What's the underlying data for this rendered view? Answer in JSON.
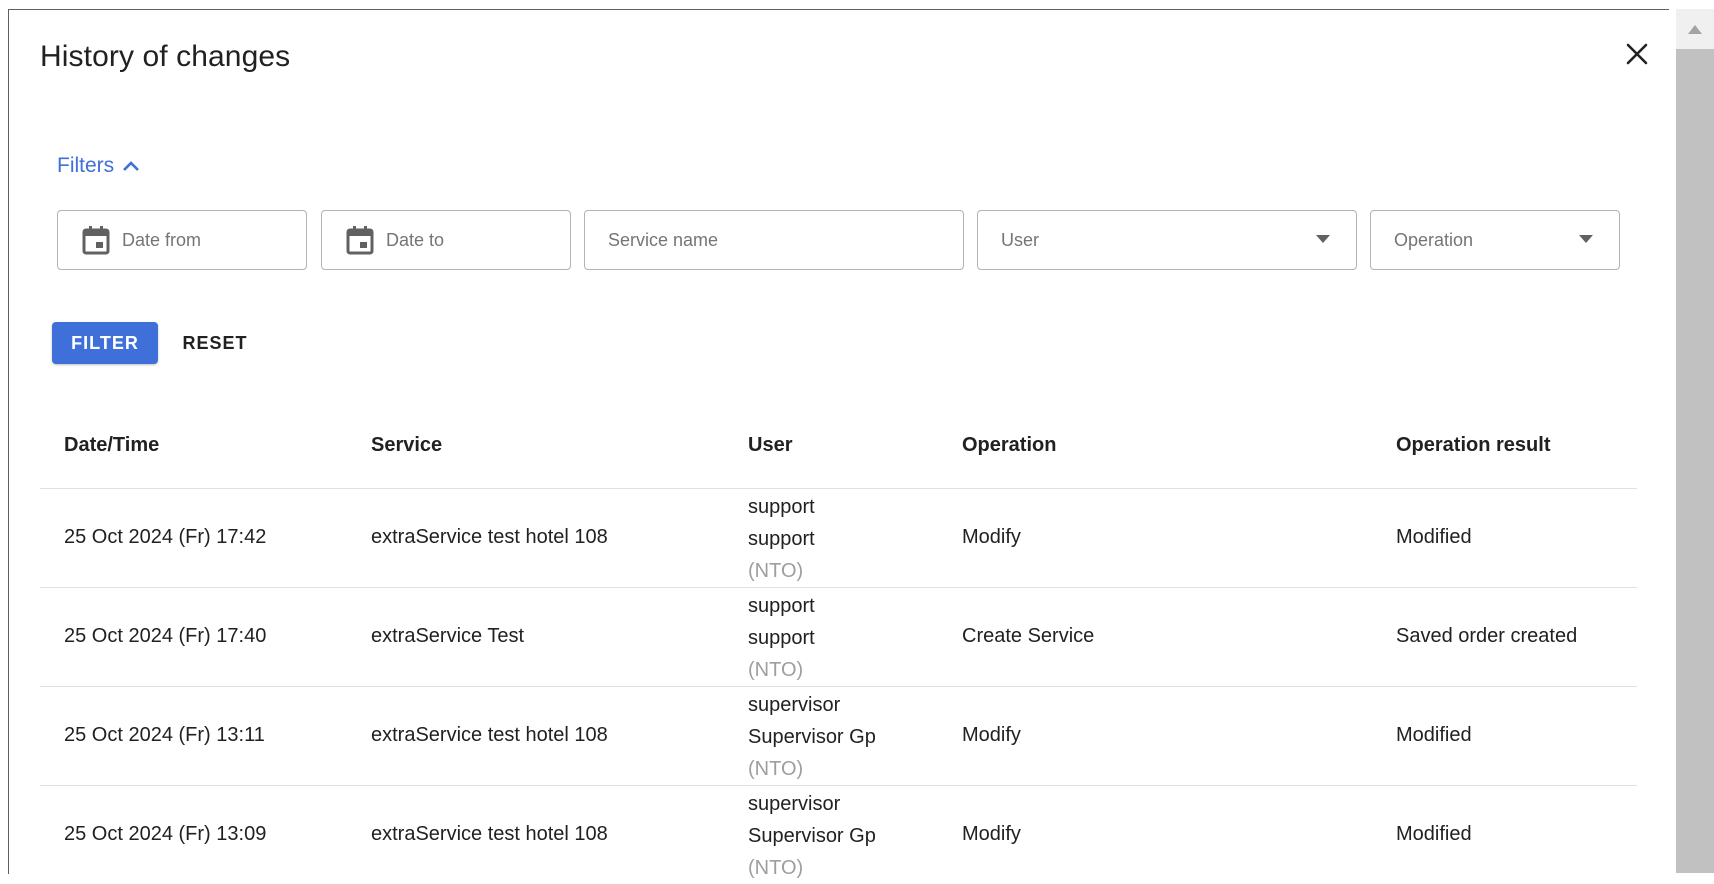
{
  "dialog": {
    "title": "History of changes",
    "close_icon": "close-icon"
  },
  "filters": {
    "toggle_label": "Filters",
    "toggle_icon": "chevron-up-icon",
    "date_from_placeholder": "Date from",
    "date_to_placeholder": "Date to",
    "service_name_placeholder": "Service name",
    "user_placeholder": "User",
    "operation_placeholder": "Operation",
    "filter_button": "FILTER",
    "reset_button": "RESET"
  },
  "table": {
    "headers": [
      "Date/Time",
      "Service",
      "User",
      "Operation",
      "Operation result"
    ],
    "rows": [
      {
        "datetime": "25 Oct 2024 (Fr) 17:42",
        "service": "extraService test hotel 108",
        "user_login": "support",
        "user_name": "support",
        "user_org": "(NTO)",
        "operation": "Modify",
        "result": "Modified"
      },
      {
        "datetime": "25 Oct 2024 (Fr) 17:40",
        "service": "extraService Test",
        "user_login": "support",
        "user_name": "support",
        "user_org": "(NTO)",
        "operation": "Create Service",
        "result": "Saved order created"
      },
      {
        "datetime": "25 Oct 2024 (Fr) 13:11",
        "service": "extraService test hotel 108",
        "user_login": "supervisor",
        "user_name": "Supervisor Gp",
        "user_org": "(NTO)",
        "operation": "Modify",
        "result": "Modified"
      },
      {
        "datetime": "25 Oct 2024 (Fr) 13:09",
        "service": "extraService test hotel 108",
        "user_login": "supervisor",
        "user_name": "Supervisor Gp",
        "user_org": "(NTO)",
        "operation": "Modify",
        "result": "Modified"
      }
    ]
  },
  "colors": {
    "accent": "#3f6fd8",
    "text": "#212121",
    "muted": "#9e9e9e",
    "border": "#b3b3b3"
  }
}
